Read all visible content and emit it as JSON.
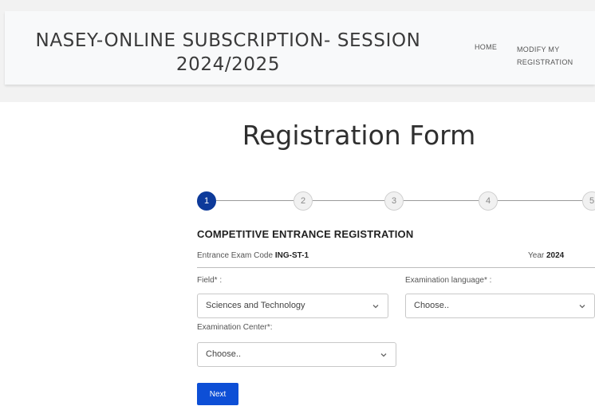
{
  "header": {
    "title_line1": "NASEY-ONLINE SUBSCRIPTION- SESSION",
    "title_line2": "2024/2025",
    "nav": {
      "home": "HOME",
      "modify_line1": "MODIFY MY",
      "modify_line2": "REGISTRATION"
    }
  },
  "form": {
    "title": "Registration Form",
    "steps": [
      "1",
      "2",
      "3",
      "4",
      "5"
    ],
    "active_step": 1,
    "section_title": "COMPETITIVE ENTRANCE REGISTRATION",
    "exam_code_label": "Entrance Exam Code",
    "exam_code_value": "ING-ST-1",
    "year_label": "Year",
    "year_value": "2024",
    "fields": {
      "field_label": "Field* :",
      "field_value": "Sciences and Technology",
      "language_label": "Examination language* :",
      "language_value": "Choose..",
      "center_label": "Examination Center*:",
      "center_value": "Choose.."
    },
    "next_label": "Next"
  },
  "colors": {
    "accent": "#0d4fd6",
    "step_active": "#0d3a9a",
    "header_bg": "#f8f9fa"
  }
}
